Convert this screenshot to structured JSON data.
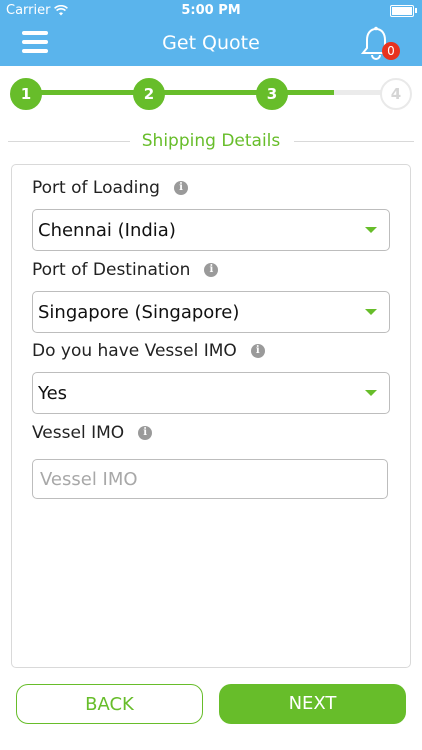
{
  "status_bar": {
    "carrier": "Carrier",
    "time": "5:00 PM",
    "wifi_icon": "wifi-icon",
    "battery_icon": "battery-icon"
  },
  "nav": {
    "title": "Get Quote",
    "menu_icon": "hamburger-menu-icon",
    "bell_icon": "bell-icon",
    "notification_count": "0"
  },
  "stepper": {
    "steps": [
      {
        "label": "1",
        "state": "done"
      },
      {
        "label": "2",
        "state": "done"
      },
      {
        "label": "3",
        "state": "current"
      },
      {
        "label": "4",
        "state": "todo"
      }
    ]
  },
  "section": {
    "title": "Shipping Details"
  },
  "form": {
    "port_of_loading": {
      "label": "Port of Loading",
      "value": "Chennai (India)"
    },
    "port_of_destination": {
      "label": "Port of Destination",
      "value": "Singapore (Singapore)"
    },
    "vessel_imo_question": {
      "label": "Do you have Vessel IMO",
      "value": "Yes"
    },
    "vessel_imo": {
      "label": "Vessel IMO",
      "value": "",
      "placeholder": "Vessel IMO"
    }
  },
  "actions": {
    "back_label": "BACK",
    "next_label": "NEXT"
  },
  "colors": {
    "accent_green": "#67bd2a",
    "header_blue": "#5ab4ec",
    "badge_red": "#e8321f"
  }
}
